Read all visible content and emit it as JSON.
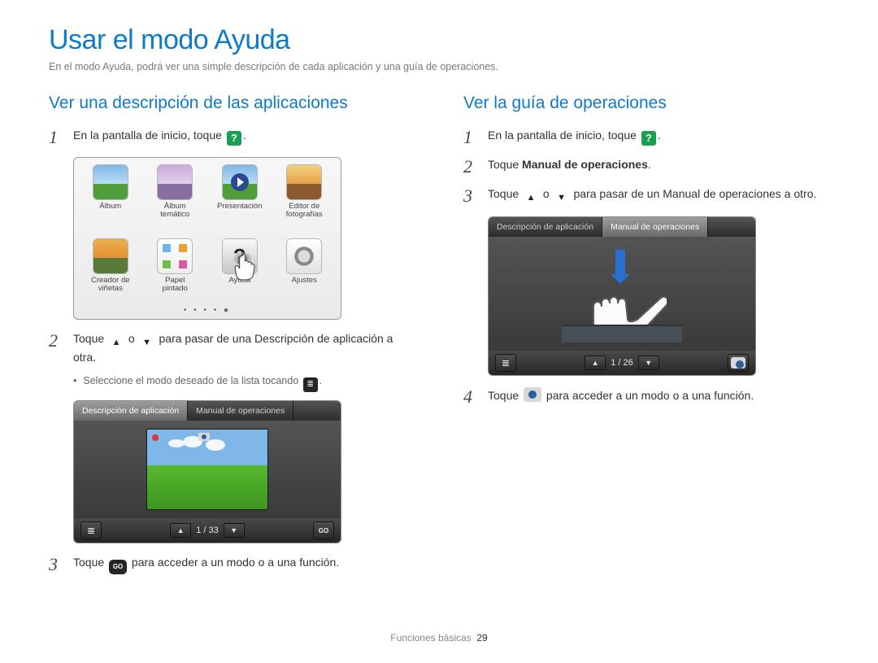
{
  "page_title": "Usar el modo Ayuda",
  "page_intro": "En el modo Ayuda, podrá ver una simple descripción de cada aplicación y una guía de operaciones.",
  "footer_section": "Funciones básicas",
  "footer_page": "29",
  "left": {
    "heading": "Ver una descripción de las aplicaciones",
    "step1_a": "En la pantalla de inicio, toque ",
    "step1_b": ".",
    "apps": [
      {
        "label": "Álbum"
      },
      {
        "label": "Álbum\ntemático"
      },
      {
        "label": "Presentación"
      },
      {
        "label": "Editor de\nfotografías"
      },
      {
        "label": "Creador de\nviñetas"
      },
      {
        "label": "Papel\npintado"
      },
      {
        "label": "Ayuda"
      },
      {
        "label": "Ajustes"
      }
    ],
    "step2_a": "Toque ",
    "step2_b": " o ",
    "step2_c": " para pasar de una Descripción de aplicación a otra.",
    "bullet_a": "Seleccione el modo deseado de la lista tocando ",
    "bullet_b": ".",
    "screen": {
      "tab1": "Descripción de aplicación",
      "tab2": "Manual de operaciones",
      "pager": "1 / 33"
    },
    "step3_a": "Toque ",
    "step3_b": " para acceder a un modo o a una función.",
    "go_label": "GO"
  },
  "right": {
    "heading": "Ver la guía de operaciones",
    "step1_a": "En la pantalla de inicio, toque ",
    "step1_b": ".",
    "step2_a": "Toque ",
    "step2_bold": "Manual de operaciones",
    "step2_b": ".",
    "step3_a": "Toque ",
    "step3_b": " o ",
    "step3_c": " para pasar de un Manual de operaciones a otro.",
    "screen": {
      "tab1": "Descripción de aplicación",
      "tab2": "Manual de operaciones",
      "pager": "1 / 26"
    },
    "step4_a": "Toque ",
    "step4_b": " para acceder a un modo o a una función."
  }
}
